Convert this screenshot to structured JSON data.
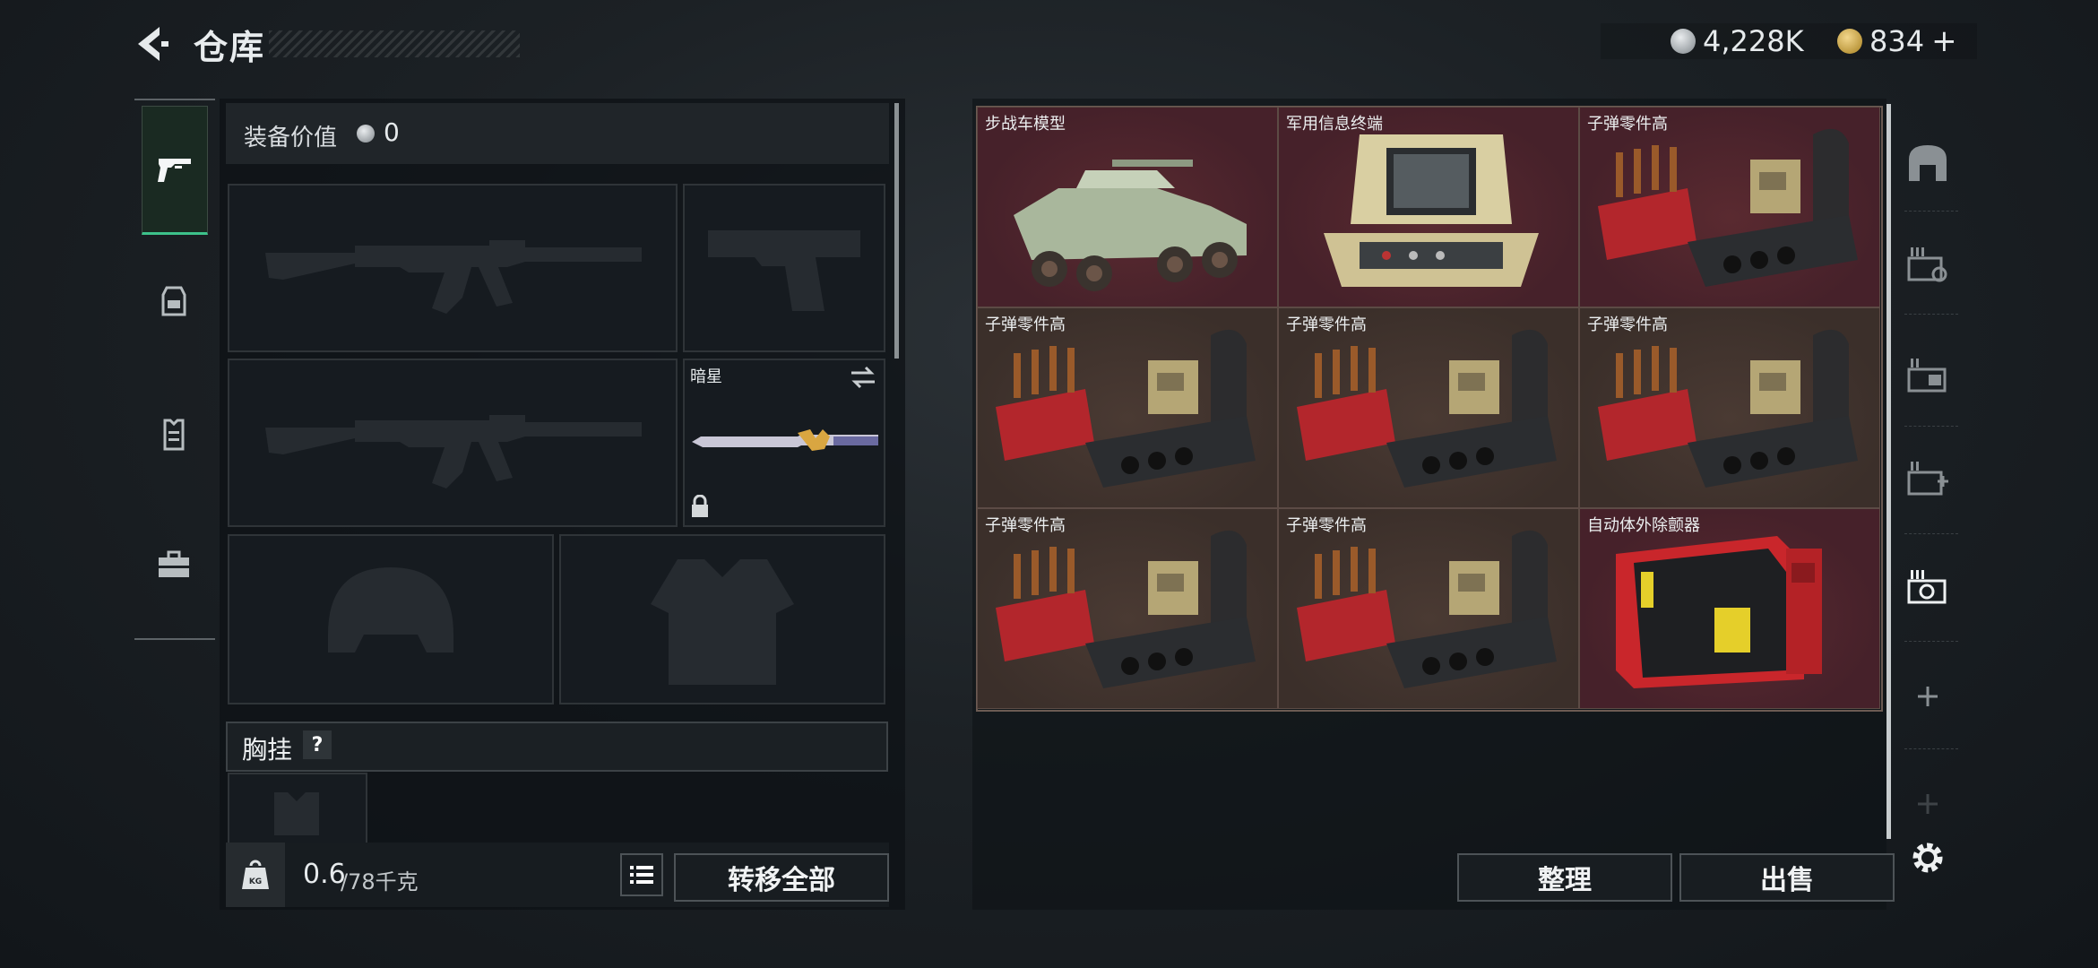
{
  "header": {
    "title": "仓库",
    "currency_silver": "4,228K",
    "currency_gold": "834",
    "gold_plus": "+"
  },
  "left": {
    "equipment_value_label": "装备价值",
    "equipment_value": "0",
    "melee_name": "暗星",
    "chest_rig_label": "胸挂",
    "chest_rig_help": "?",
    "weight_current": "0.6",
    "weight_max": "/78千克",
    "transfer_all": "转移全部"
  },
  "tabs": [
    "gun-icon",
    "backpack-icon",
    "armor-vest-icon",
    "toolbox-icon"
  ],
  "grid": {
    "items": [
      {
        "name": "步战车模型",
        "bg": "red",
        "art": "ifv"
      },
      {
        "name": "军用信息终端",
        "bg": "red",
        "art": "terminal"
      },
      {
        "name": "子弹零件高",
        "bg": "red",
        "art": "ammo"
      },
      {
        "name": "子弹零件高",
        "bg": "brown",
        "art": "ammo"
      },
      {
        "name": "子弹零件高",
        "bg": "brown",
        "art": "ammo"
      },
      {
        "name": "子弹零件高",
        "bg": "brown",
        "art": "ammo"
      },
      {
        "name": "子弹零件高",
        "bg": "brown",
        "art": "ammo"
      },
      {
        "name": "子弹零件高",
        "bg": "brown",
        "art": "ammo"
      },
      {
        "name": "自动体外除颤器",
        "bg": "red",
        "art": "aed"
      }
    ]
  },
  "right": {
    "sort": "整理",
    "sell": "出售"
  },
  "sidebar": [
    "home-icon",
    "storage-1-icon",
    "storage-2-icon",
    "storage-add-icon",
    "storage-4-icon",
    "add-icon",
    "add-icon-faded",
    "settings-icon"
  ],
  "colors": {
    "accent_green": "#3dc28b",
    "cell_red": "#4d2530",
    "cell_brown": "#3e312b"
  }
}
